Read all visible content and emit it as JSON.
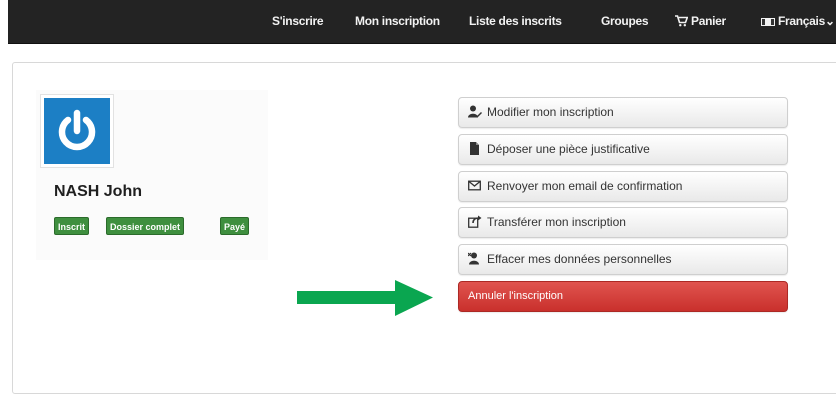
{
  "navbar": {
    "items": [
      {
        "label": "S'inscrire"
      },
      {
        "label": "Mon inscription"
      },
      {
        "label": "Liste des inscrits"
      },
      {
        "label": "Groupes"
      },
      {
        "label": "Panier",
        "icon": "cart-icon"
      },
      {
        "label": "Français",
        "icon": "flag-icon"
      }
    ]
  },
  "profile": {
    "name": "NASH John",
    "avatar_icon": "power-icon",
    "badges": [
      "Inscrit",
      "Dossier complet",
      "Payé"
    ]
  },
  "actions": [
    {
      "label": "Modifier mon inscription",
      "icon": "user-edit-icon"
    },
    {
      "label": "Déposer une pièce justificative",
      "icon": "file-icon"
    },
    {
      "label": "Renvoyer mon email de confirmation",
      "icon": "envelope-icon"
    },
    {
      "label": "Transférer mon inscription",
      "icon": "share-icon"
    },
    {
      "label": "Effacer mes données personnelles",
      "icon": "user-remove-icon"
    },
    {
      "label": "Annuler l'inscription",
      "icon": ""
    }
  ],
  "colors": {
    "navbar": "#232323",
    "avatar": "#1c7fc5",
    "badge": "#3f8f3f",
    "danger": "#d9534f",
    "arrow": "#0aa650"
  },
  "annotation": {
    "icon": "green-arrow-icon"
  }
}
